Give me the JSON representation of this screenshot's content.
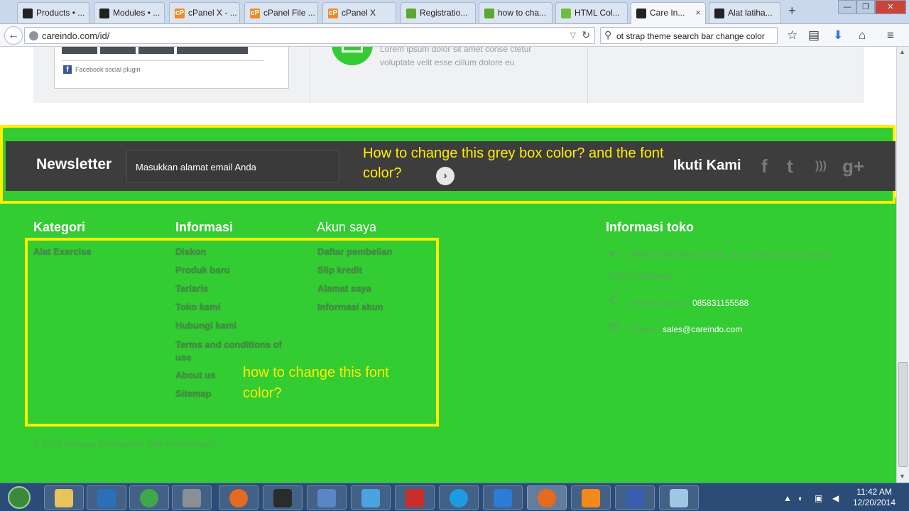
{
  "browser": {
    "tabs": [
      {
        "label": "Products • ...",
        "icon": "site-icon",
        "color": "#222222"
      },
      {
        "label": "Modules • ...",
        "icon": "site-icon",
        "color": "#222222"
      },
      {
        "label": "cPanel X - ...",
        "icon": "cpanel-icon",
        "color": "#f08a24"
      },
      {
        "label": "cPanel File ...",
        "icon": "cpanel-icon",
        "color": "#f08a24"
      },
      {
        "label": "cPanel X",
        "icon": "cpanel-icon",
        "color": "#f08a24"
      },
      {
        "label": "Registratio...",
        "icon": "site-icon",
        "color": "#5aa832"
      },
      {
        "label": "how to cha...",
        "icon": "site-icon",
        "color": "#5aa832"
      },
      {
        "label": "HTML Col...",
        "icon": "site-icon",
        "color": "#6cbf3c"
      },
      {
        "label": "Care In...",
        "icon": "site-icon",
        "color": "#222222"
      },
      {
        "label": "Alat latiha...",
        "icon": "site-icon",
        "color": "#222222"
      }
    ],
    "url": "careindo.com/id/",
    "search_text": "ot strap theme search bar change color",
    "cpanel_glyph": "cP"
  },
  "top_section": {
    "fb_plugin_label": "Facebook social plugin",
    "fb_glyph": "f",
    "lorem_line1": "Lorem ipsum dolor sit amet conse ctetur",
    "lorem_line2": "voluptate velit esse cillum dolore eu"
  },
  "newsletter": {
    "title": "Newsletter",
    "input_placeholder": "Masukkan alamat email Anda",
    "go_glyph": "›",
    "follow_title": "Ikuti Kami",
    "social_icons": [
      "facebook-icon",
      "twitter-icon",
      "rss-icon",
      "google-plus-icon"
    ],
    "social_glyphs": [
      "f",
      "t",
      ")))",
      "g+"
    ],
    "bar_color": "#3d3d3d"
  },
  "annotations": {
    "grey_box_question": "How to change this grey box color? and the font color?",
    "font_color_question": "how to change this font color?",
    "highlight_color": "#ffee00"
  },
  "footer": {
    "background": "#33cc33",
    "kategori": {
      "title": "Kategori",
      "links": [
        "Alat Exercise"
      ]
    },
    "informasi": {
      "title": "Informasi",
      "links": [
        "Diskon",
        "Produk baru",
        "Terlaris",
        "Toko kami",
        "Hubungi kami",
        "Terms and conditions of use",
        "About us",
        "Sitemap"
      ]
    },
    "akun": {
      "title": "Akun saya",
      "links": [
        "Daftar pembelian",
        "Slip kredit",
        "Alamat saya",
        "Informasi akun"
      ]
    },
    "toko": {
      "title": "Informasi toko",
      "address_line1": "WWW.CAREINDO.COM, Jln. Sei Kera No.28 Medan",
      "address_line2": "-20232 Indonesia",
      "phone_label": "Hubungi kami:",
      "phone_value": "085831155588",
      "email_label": "E-mail:",
      "email_value": "sales@careindo.com"
    },
    "copyright": "© 2014 Software Ecommerce oleh PrestaShop™"
  },
  "taskbar": {
    "time": "11:42 AM",
    "date": "12/20/2014"
  }
}
